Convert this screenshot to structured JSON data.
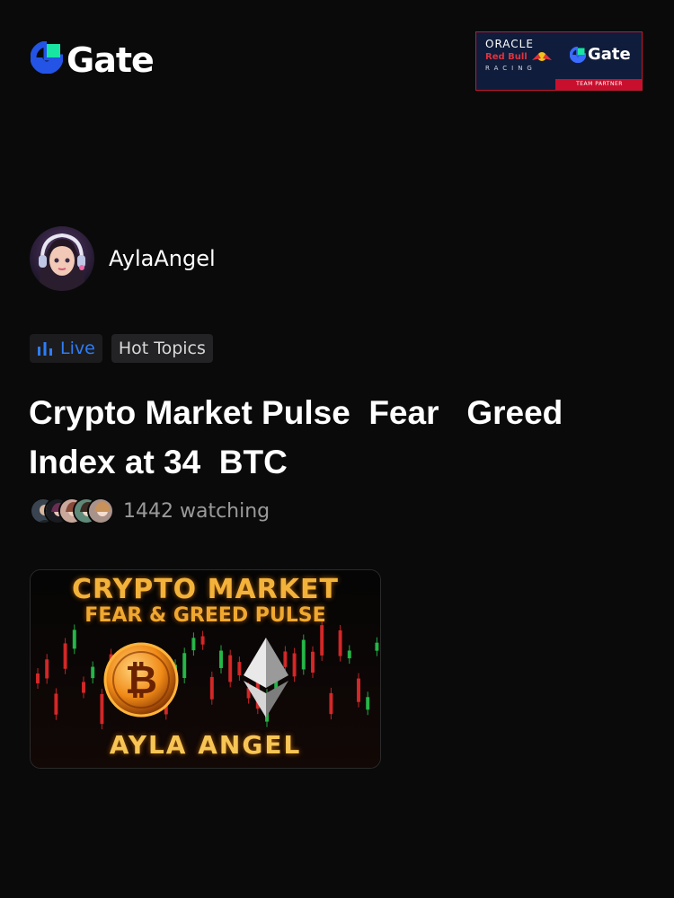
{
  "header": {
    "brand": "Gate",
    "partner": {
      "oracle": "ORACLE",
      "redbull": "Red Bull",
      "racing": "RACING",
      "gate": "Gate",
      "strip": "TEAM PARTNER"
    }
  },
  "author": {
    "name": "AylaAngel"
  },
  "tags": {
    "live": "Live",
    "hot": "Hot Topics"
  },
  "post": {
    "title": "Crypto Market Pulse  Fear   Greed\nIndex at 34  BTC",
    "watching": "1442 watching"
  },
  "thumbnail": {
    "line1": "CRYPTO MARKET",
    "line2": "FEAR & GREED PULSE",
    "line3": "AYLA ANGEL",
    "coin_symbol": "₿"
  },
  "colors": {
    "background": "#0a0a0a",
    "live_blue": "#2f7cf6",
    "gate_blue": "#2354e6",
    "gate_green": "#17e5a1",
    "thumb_gold": "#f3b23a"
  },
  "icons": {
    "brand": "gate-logo-icon",
    "live": "bar-chart-icon"
  }
}
